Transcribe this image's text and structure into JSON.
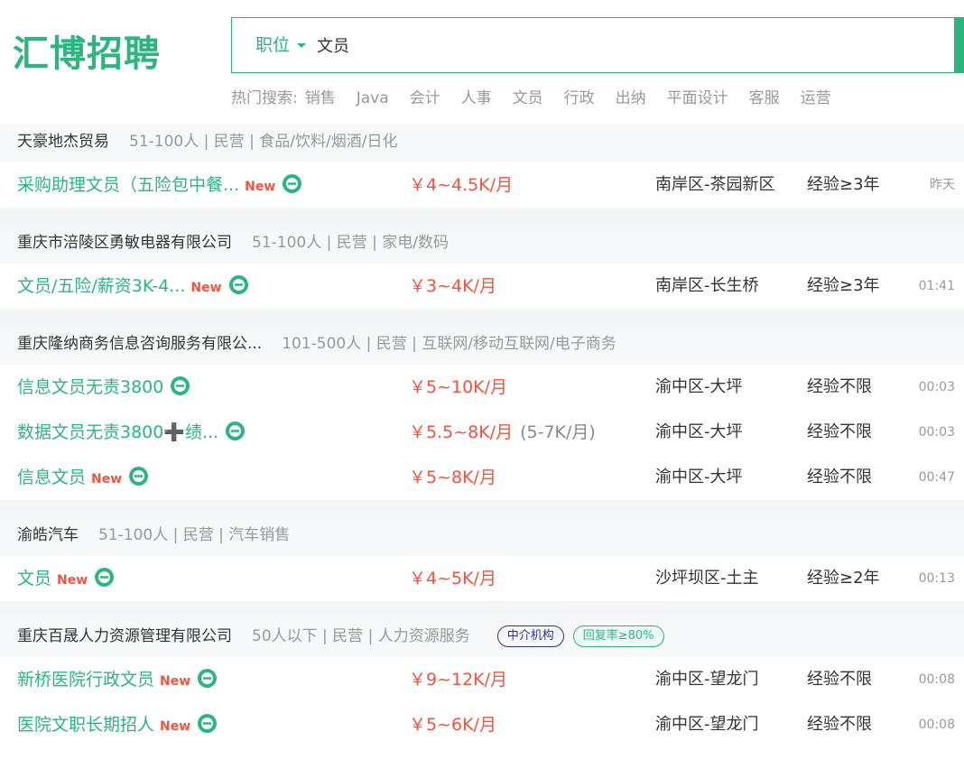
{
  "brand": {
    "logo": "汇博招聘",
    "accent": "#2bb57f",
    "salary_color": "#f5533d"
  },
  "search": {
    "category": "职位",
    "query": "文员"
  },
  "hot_search": {
    "label": "热门搜索:",
    "items": [
      "销售",
      "Java",
      "会计",
      "人事",
      "文员",
      "行政",
      "出纳",
      "平面设计",
      "客服",
      "运营"
    ]
  },
  "new_label": "New",
  "companies": [
    {
      "name": "天豪地杰贸易",
      "info": "51-100人 | 民营 | 食品/饮料/烟酒/日化",
      "jobs": [
        {
          "title": "采购助理文员（五险包中餐...",
          "is_new": true,
          "salary": "￥4~4.5K/月",
          "location": "南岸区-茶园新区",
          "experience": "经验≥3年",
          "time": "昨天"
        }
      ]
    },
    {
      "name": "重庆市涪陵区勇敏电器有限公司",
      "info": "51-100人 | 民营 | 家电/数码",
      "jobs": [
        {
          "title": "文员/五险/薪资3K-4...",
          "is_new": true,
          "salary": "￥3~4K/月",
          "location": "南岸区-长生桥",
          "experience": "经验≥3年",
          "time": "01:41"
        }
      ]
    },
    {
      "name": "重庆隆纳商务信息咨询服务有限公...",
      "info": "101-500人 | 民营 | 互联网/移动互联网/电子商务",
      "jobs": [
        {
          "title": "信息文员无责3800",
          "is_new": false,
          "salary": "￥5~10K/月",
          "location": "渝中区-大坪",
          "experience": "经验不限",
          "time": "00:03"
        },
        {
          "title": "数据文员无责3800➕绩...",
          "is_new": false,
          "salary": "￥5.5~8K/月",
          "salary_orig": "(5-7K/月)",
          "location": "渝中区-大坪",
          "experience": "经验不限",
          "time": "00:03"
        },
        {
          "title": "信息文员",
          "is_new": true,
          "salary": "￥5~8K/月",
          "location": "渝中区-大坪",
          "experience": "经验不限",
          "time": "00:47"
        }
      ]
    },
    {
      "name": "渝皓汽车",
      "info": "51-100人 | 民营 | 汽车销售",
      "jobs": [
        {
          "title": "文员",
          "is_new": true,
          "salary": "￥4~5K/月",
          "location": "沙坪坝区-土主",
          "experience": "经验≥2年",
          "time": "00:13"
        }
      ]
    },
    {
      "name": "重庆百晟人力资源管理有限公司",
      "info": "50人以下 | 民营 | 人力资源服务",
      "tags": [
        "中介机构",
        "回复率≥80%"
      ],
      "jobs": [
        {
          "title": "新桥医院行政文员",
          "is_new": true,
          "salary": "￥9~12K/月",
          "location": "渝中区-望龙门",
          "experience": "经验不限",
          "time": "00:08"
        },
        {
          "title": "医院文职长期招人",
          "is_new": true,
          "salary": "￥5~6K/月",
          "location": "渝中区-望龙门",
          "experience": "经验不限",
          "time": "00:08"
        }
      ]
    }
  ]
}
